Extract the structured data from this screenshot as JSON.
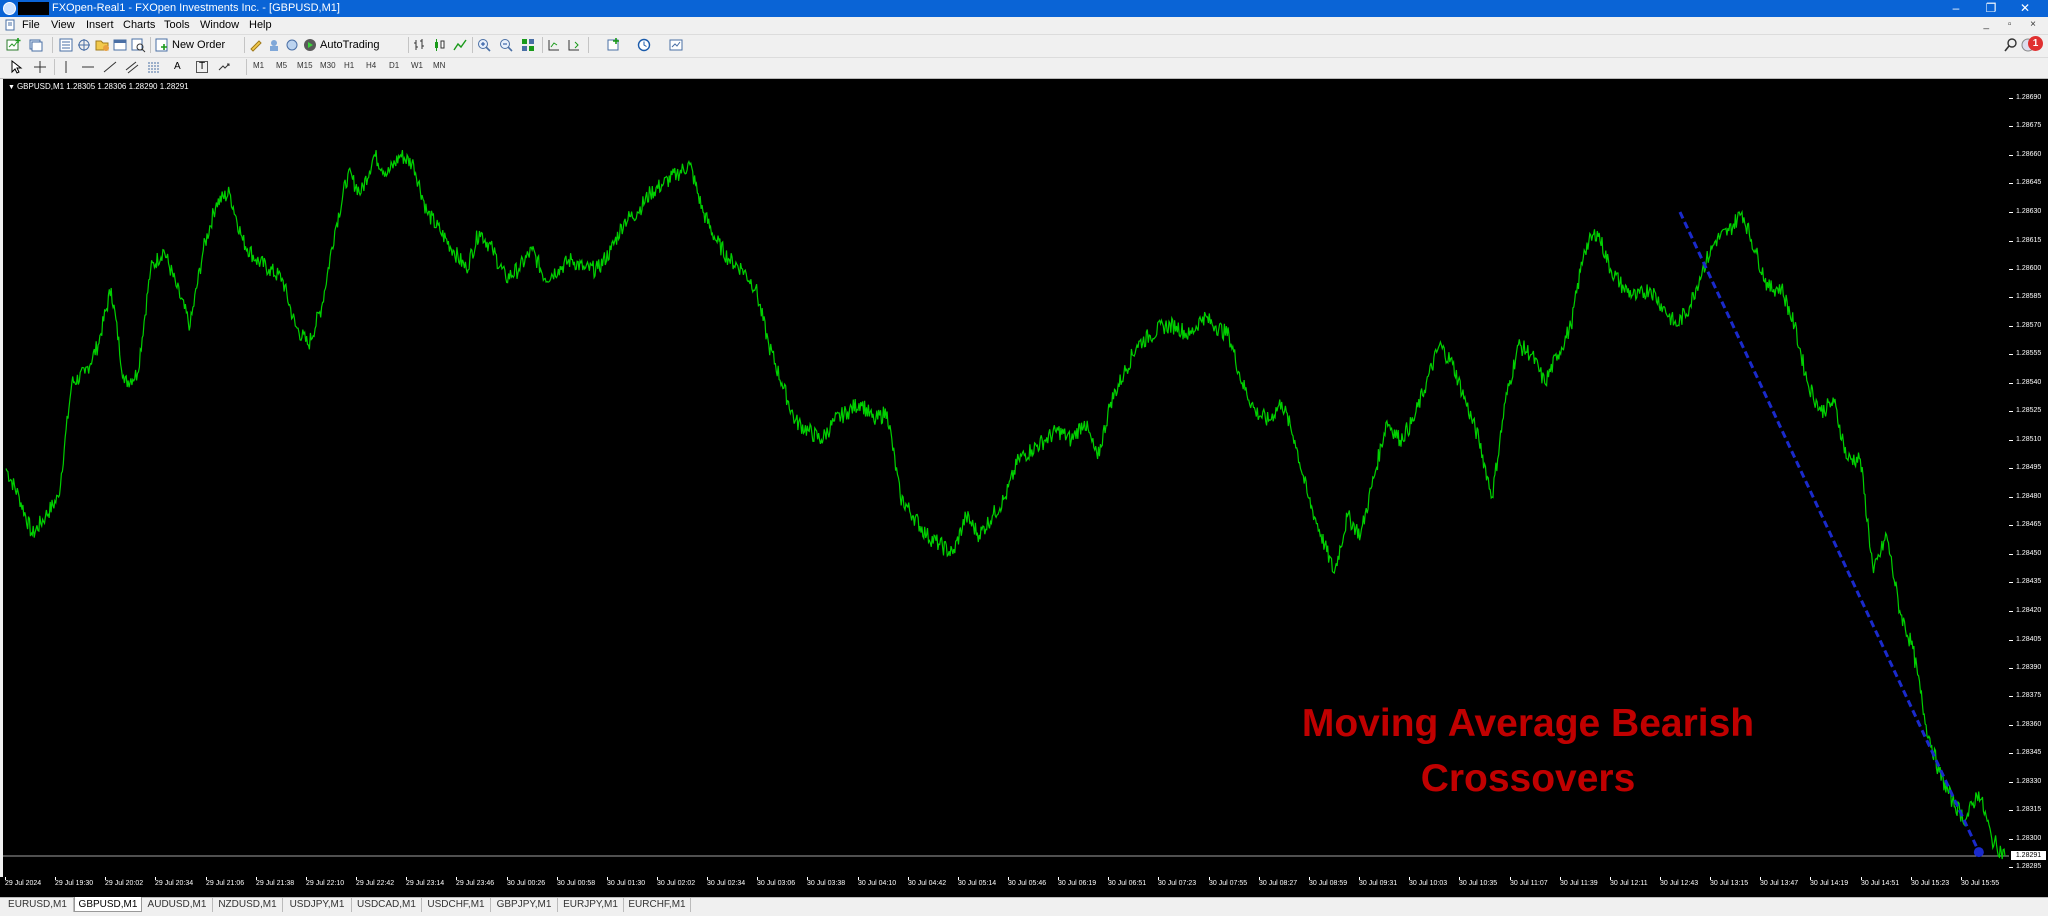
{
  "window": {
    "title": "FXOpen-Real1 - FXOpen Investments Inc. - [GBPUSD,M1]",
    "controls": [
      "–",
      "❐",
      "✕"
    ],
    "mdi_controls": "_ ▫ ×"
  },
  "menu": [
    "File",
    "View",
    "Insert",
    "Charts",
    "Tools",
    "Window",
    "Help"
  ],
  "toolbar": {
    "new_order": "New Order",
    "autotrading": "AutoTrading",
    "notification_count": "1",
    "text_tool": "A",
    "label_tool": "T"
  },
  "timeframes": [
    "M1",
    "M5",
    "M15",
    "M30",
    "H1",
    "H4",
    "D1",
    "W1",
    "MN"
  ],
  "chart": {
    "info": "GBPUSD,M1  1.28305 1.28306 1.28290 1.28291",
    "current_price": "1.28291",
    "overlay_line1": "Moving Average Bearish",
    "overlay_line2": "Crossovers",
    "line_color": "#00d000",
    "trendline_color": "#1a2acc",
    "overlay_color": "#c00000"
  },
  "chart_data": {
    "type": "line",
    "symbol": "GBPUSD",
    "timeframe": "M1",
    "ylim": [
      1.2828,
      1.287
    ],
    "yticks": [
      "1.28690",
      "1.28675",
      "1.28660",
      "1.28645",
      "1.28630",
      "1.28615",
      "1.28600",
      "1.28585",
      "1.28570",
      "1.28555",
      "1.28540",
      "1.28525",
      "1.28510",
      "1.28495",
      "1.28480",
      "1.28465",
      "1.28450",
      "1.28435",
      "1.28420",
      "1.28405",
      "1.28390",
      "1.28375",
      "1.28360",
      "1.28345",
      "1.28330",
      "1.28315",
      "1.28300",
      "1.28285"
    ],
    "xticks": [
      "29 Jul 2024",
      "29 Jul 19:30",
      "29 Jul 20:02",
      "29 Jul 20:34",
      "29 Jul 21:06",
      "29 Jul 21:38",
      "29 Jul 22:10",
      "29 Jul 22:42",
      "29 Jul 23:14",
      "29 Jul 23:46",
      "30 Jul 00:26",
      "30 Jul 00:58",
      "30 Jul 01:30",
      "30 Jul 02:02",
      "30 Jul 02:34",
      "30 Jul 03:06",
      "30 Jul 03:38",
      "30 Jul 04:10",
      "30 Jul 04:42",
      "30 Jul 05:14",
      "30 Jul 05:46",
      "30 Jul 06:19",
      "30 Jul 06:51",
      "30 Jul 07:23",
      "30 Jul 07:55",
      "30 Jul 08:27",
      "30 Jul 08:59",
      "30 Jul 09:31",
      "30 Jul 10:03",
      "30 Jul 10:35",
      "30 Jul 11:07",
      "30 Jul 11:39",
      "30 Jul 12:11",
      "30 Jul 12:43",
      "30 Jul 13:15",
      "30 Jul 13:47",
      "30 Jul 14:19",
      "30 Jul 14:51",
      "30 Jul 15:23",
      "30 Jul 15:55"
    ],
    "series": [
      {
        "values": [
          1.28495,
          1.2848,
          1.2846,
          1.2847,
          1.2848,
          1.2854,
          1.28545,
          1.2856,
          1.2859,
          1.2854,
          1.28545,
          1.286,
          1.2861,
          1.2859,
          1.2857,
          1.2861,
          1.28635,
          1.2864,
          1.28615,
          1.28605,
          1.286,
          1.28595,
          1.2857,
          1.2856,
          1.2858,
          1.2862,
          1.2865,
          1.2864,
          1.2866,
          1.2865,
          1.2866,
          1.28655,
          1.2863,
          1.2862,
          1.2861,
          1.286,
          1.2862,
          1.2861,
          1.28595,
          1.286,
          1.2861,
          1.28595,
          1.286,
          1.28605,
          1.286,
          1.286,
          1.2861,
          1.28625,
          1.2863,
          1.2864,
          1.28645,
          1.2865,
          1.28655,
          1.2863,
          1.28615,
          1.28605,
          1.286,
          1.2859,
          1.2856,
          1.2854,
          1.2852,
          1.28515,
          1.2851,
          1.2852,
          1.28525,
          1.2853,
          1.2852,
          1.28525,
          1.2848,
          1.2847,
          1.2846,
          1.28455,
          1.2845,
          1.2847,
          1.2846,
          1.2847,
          1.2848,
          1.285,
          1.28505,
          1.2851,
          1.28515,
          1.2851,
          1.2852,
          1.285,
          1.2853,
          1.28545,
          1.2856,
          1.28565,
          1.2857,
          1.2857,
          1.28565,
          1.28575,
          1.2857,
          1.28565,
          1.2854,
          1.28525,
          1.2852,
          1.2853,
          1.2851,
          1.2848,
          1.2846,
          1.2844,
          1.2847,
          1.2846,
          1.2849,
          1.2852,
          1.2851,
          1.2852,
          1.2854,
          1.2856,
          1.2855,
          1.2853,
          1.2851,
          1.2848,
          1.2853,
          1.2856,
          1.28555,
          1.2854,
          1.28555,
          1.2857,
          1.2861,
          1.2862,
          1.286,
          1.2859,
          1.28585,
          1.2859,
          1.2858,
          1.2857,
          1.2858,
          1.286,
          1.28615,
          1.2862,
          1.2863,
          1.2861,
          1.2859,
          1.2859,
          1.2857,
          1.2854,
          1.28525,
          1.2853,
          1.285,
          1.285,
          1.2844,
          1.2846,
          1.2842,
          1.284,
          1.2836,
          1.28335,
          1.2832,
          1.2831,
          1.28325,
          1.283,
          1.28291
        ]
      }
    ],
    "annotations": [
      {
        "type": "trendline",
        "from": [
          "30 Jul 12:43",
          1.2863
        ],
        "to": [
          "30 Jul 15:55",
          1.28291
        ],
        "style": "dashed"
      },
      {
        "type": "text",
        "text": "Moving Average Bearish Crossovers",
        "color": "#c00000"
      }
    ]
  },
  "tabs": [
    "EURUSD,M1",
    "GBPUSD,M1",
    "AUDUSD,M1",
    "NZDUSD,M1",
    "USDJPY,M1",
    "USDCAD,M1",
    "USDCHF,M1",
    "GBPJPY,M1",
    "EURJPY,M1",
    "EURCHF,M1"
  ],
  "active_tab": "GBPUSD,M1"
}
